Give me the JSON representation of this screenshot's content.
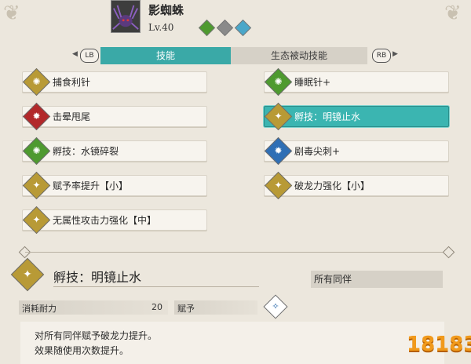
{
  "monster": {
    "name": "影蜘蛛",
    "level": "Lv.40",
    "elements": [
      {
        "icon": "grass-element-icon",
        "color": "#4e9a2f"
      },
      {
        "icon": "stone-element-icon",
        "color": "#8a8a8a"
      },
      {
        "icon": "water-element-icon",
        "color": "#4aa7c9"
      }
    ]
  },
  "tabs": {
    "left_button": "LB",
    "right_button": "RB",
    "active": "技能",
    "inactive": "生态被动技能"
  },
  "skills_left": [
    {
      "label": "捕食利针",
      "icon": "yellow-burst-icon",
      "color": "#b89a36"
    },
    {
      "label": "击晕甩尾",
      "icon": "red-spike-icon",
      "color": "#b2282a"
    },
    {
      "label": "孵技：水镜碎裂",
      "icon": "green-burst-icon",
      "color": "#4e9a2f"
    },
    {
      "label": "赋予率提升【小】",
      "icon": "yellow-figure-icon",
      "color": "#b89a36"
    },
    {
      "label": "无属性攻击力强化【中】",
      "icon": "yellow-figure-icon",
      "color": "#b89a36"
    }
  ],
  "skills_right": [
    {
      "label": "睡眠针+",
      "icon": "green-burst-icon",
      "color": "#4e9a2f"
    },
    {
      "label": "孵技：明镜止水",
      "icon": "yellow-figure-icon",
      "color": "#b89a36",
      "selected": true
    },
    {
      "label": "剧毒尖刺+",
      "icon": "blue-spike-icon",
      "color": "#2f6fb5"
    },
    {
      "label": "破龙力强化【小】",
      "icon": "yellow-figure-icon",
      "color": "#b89a36"
    }
  ],
  "detail": {
    "icon": "yellow-figure-icon",
    "title": "孵技：明镜止水",
    "target": "所有同伴",
    "stamina_label": "消耗耐力",
    "stamina_value": "20",
    "type_label": "赋予",
    "type_icon": "buff-type-icon",
    "description": [
      "对所有同伴赋予破龙力提升。",
      "效果随使用次数提升。"
    ]
  },
  "watermark": "18183",
  "colors": {
    "accent": "#3bb5b1",
    "background": "#ece7dd"
  }
}
